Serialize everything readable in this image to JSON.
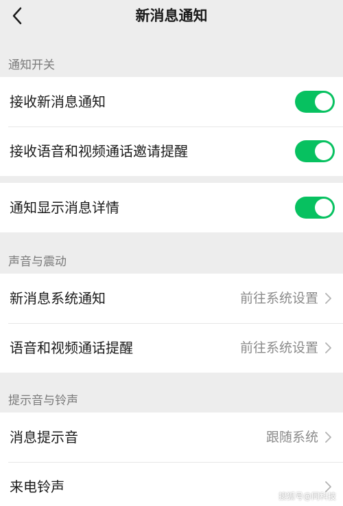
{
  "header": {
    "title": "新消息通知",
    "back_icon": "chevron-left-icon"
  },
  "sections": [
    {
      "title": "通知开关"
    },
    {
      "title": ""
    },
    {
      "title": "声音与震动"
    },
    {
      "title": "提示音与铃声"
    }
  ],
  "notify": {
    "receive_new_label": "接收新消息通知",
    "receive_new_on": true,
    "receive_call_label": "接收语音和视频通话邀请提醒",
    "receive_call_on": true
  },
  "detail": {
    "show_detail_label": "通知显示消息详情",
    "show_detail_on": true
  },
  "sound": {
    "new_msg_label": "新消息系统通知",
    "new_msg_value": "前往系统设置",
    "call_label": "语音和视频通话提醒",
    "call_value": "前往系统设置"
  },
  "ringtone": {
    "msg_tone_label": "消息提示音",
    "msg_tone_value": "跟随系统",
    "call_ring_label": "来电铃声",
    "call_ring_value": ""
  },
  "watermark": "搜狐号@同科技",
  "colors": {
    "accent": "#07c160",
    "background": "#ededed"
  }
}
